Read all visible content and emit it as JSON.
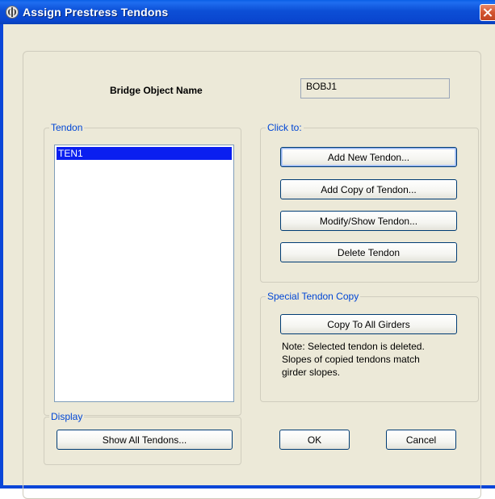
{
  "window": {
    "title": "Assign Prestress Tendons"
  },
  "bridge": {
    "label": "Bridge Object Name",
    "value": "BOBJ1"
  },
  "tendon_group": {
    "label": "Tendon",
    "items": [
      "TEN1"
    ],
    "selected": "TEN1"
  },
  "click_group": {
    "label": "Click to:",
    "add_new": "Add New Tendon...",
    "add_copy": "Add Copy of Tendon...",
    "modify_show": "Modify/Show Tendon...",
    "delete": "Delete Tendon"
  },
  "special_group": {
    "label": "Special Tendon Copy",
    "copy_all": "Copy To All Girders",
    "note_line1": "Note:  Selected tendon is deleted.",
    "note_line2": "Slopes of copied tendons match",
    "note_line3": "girder slopes."
  },
  "display_group": {
    "label": "Display",
    "show_all": "Show All Tendons..."
  },
  "footer": {
    "ok": "OK",
    "cancel": "Cancel"
  },
  "colors": {
    "titlebar": "#0a46d8",
    "dialog_bg": "#ece9d8",
    "group_label": "#0046d5",
    "selection": "#0a1ff0"
  }
}
